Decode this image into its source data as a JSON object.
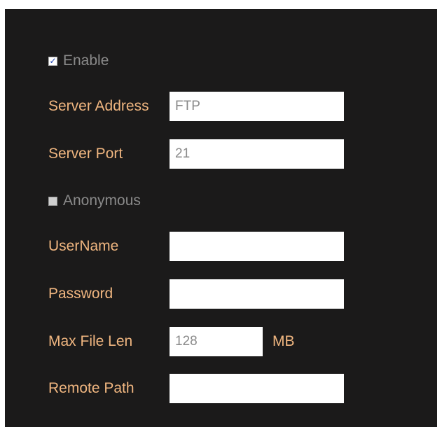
{
  "enable": {
    "label": "Enable",
    "checked": true
  },
  "server_address": {
    "label": "Server Address",
    "value": "FTP"
  },
  "server_port": {
    "label": "Server Port",
    "value": "21"
  },
  "anonymous": {
    "label": "Anonymous",
    "checked": false
  },
  "username": {
    "label": "UserName",
    "value": ""
  },
  "password": {
    "label": "Password",
    "value": ""
  },
  "max_file_len": {
    "label": "Max File Len",
    "value": "128",
    "unit": "MB"
  },
  "remote_path": {
    "label": "Remote Path",
    "value": ""
  },
  "colors": {
    "panel_background": "#1b1a1a",
    "label_text": "#f0b680",
    "disabled_text": "#8a8a8a",
    "input_background": "#ffffff",
    "checkmark": "#1a3fb0"
  }
}
